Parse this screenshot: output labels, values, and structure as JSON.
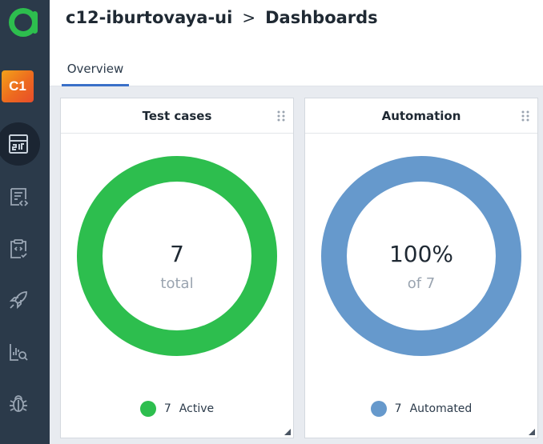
{
  "sidebar": {
    "project_badge": "C1",
    "items": [
      {
        "icon": "dashboard-icon",
        "active": true
      },
      {
        "icon": "test-cases-icon",
        "active": false
      },
      {
        "icon": "test-plan-icon",
        "active": false
      },
      {
        "icon": "launches-icon",
        "active": false
      },
      {
        "icon": "analytics-icon",
        "active": false
      },
      {
        "icon": "defects-icon",
        "active": false
      }
    ]
  },
  "header": {
    "project": "c12-iburtovaya-ui",
    "separator": ">",
    "page": "Dashboards"
  },
  "tabs": [
    {
      "label": "Overview",
      "active": true
    }
  ],
  "widgets": [
    {
      "title": "Test cases",
      "value": "7",
      "subtitle": "total",
      "color": "#2dbe4e",
      "legend": {
        "count": "7",
        "label": "Active"
      }
    },
    {
      "title": "Automation",
      "value": "100%",
      "subtitle": "of 7",
      "color": "#6699cc",
      "legend": {
        "count": "7",
        "label": "Automated"
      }
    }
  ],
  "colors": {
    "sidebar": "#2b3a4a",
    "accent": "#3a70c8",
    "logo": "#2dbe4e",
    "badge": "#ef7a1d"
  }
}
